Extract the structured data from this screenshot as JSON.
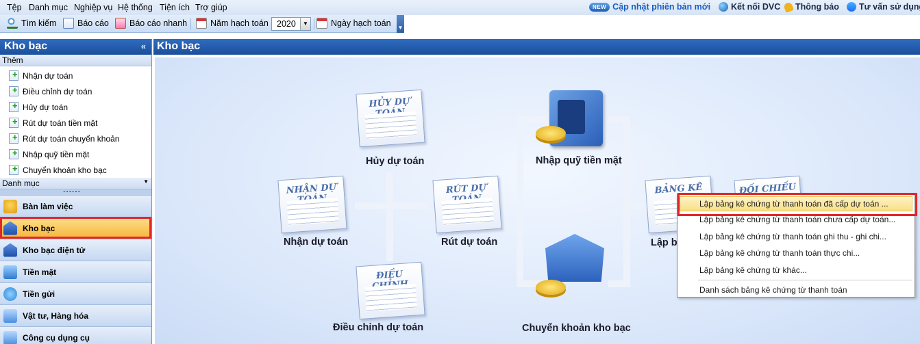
{
  "menu": [
    "Tệp",
    "Danh mục",
    "Nghiệp vụ",
    "Hệ thống",
    "Tiện ích",
    "Trợ giúp"
  ],
  "notices": {
    "new_badge": "NEW",
    "update": "Cập nhật phiên bản mới",
    "connect": "Kết nối DVC",
    "notify": "Thông báo",
    "consult": "Tư vấn sử dụng"
  },
  "toolbar": {
    "search": "Tìm kiếm",
    "report": "Báo cáo",
    "quick_report": "Báo cáo nhanh",
    "fiscal_year_label": "Năm hạch toán",
    "fiscal_year_value": "2020",
    "posting_date": "Ngày hạch toán"
  },
  "sidebar": {
    "title": "Kho bạc",
    "add_section": "Thêm",
    "add_items": [
      "Nhận dự toán",
      "Điều chỉnh dự toán",
      "Hủy dự toán",
      "Rút dự toán tiền mặt",
      "Rút dự toán chuyển khoản",
      "Nhập quỹ tiền mặt",
      "Chuyển khoản kho bạc"
    ],
    "category_section": "Danh mục",
    "nav": [
      "Bàn làm việc",
      "Kho bạc",
      "Kho bạc điện tử",
      "Tiền mặt",
      "Tiền gửi",
      "Vật tư, Hàng hóa",
      "Công cụ dụng cụ"
    ]
  },
  "main": {
    "title": "Kho bạc",
    "docs": {
      "cancel": "HỦY DỰ TOÁN",
      "receive": "NHẬN DỰ TOÁN",
      "withdraw": "RÚT DỰ TOÁN",
      "adjust": "ĐIỀU CHỈNH",
      "statement": "BẢNG KÊ",
      "reconcile": "ĐỐI CHIẾU"
    },
    "steps": {
      "cancel": "Hủy dự toán",
      "receive": "Nhận dự toán",
      "withdraw": "Rút dự toán",
      "adjust": "Điều chỉnh dự toán",
      "cash_in": "Nhập quỹ tiền mặt",
      "transfer": "Chuyển khoản kho bạc",
      "statement": "Lập bả"
    }
  },
  "context_menu": [
    "Lập bảng kê chứng từ thanh toán đã cấp dự toán ...",
    "Lập bảng kê chứng từ thanh toán chưa cấp dự toán...",
    "Lập bảng kê chứng từ thanh toán ghi thu - ghi chi...",
    "Lập bảng kê chứng từ thanh toán thực chi...",
    "Lập bảng kê chứng từ khác...",
    "Danh sách bảng kê chứng từ thanh toán"
  ]
}
